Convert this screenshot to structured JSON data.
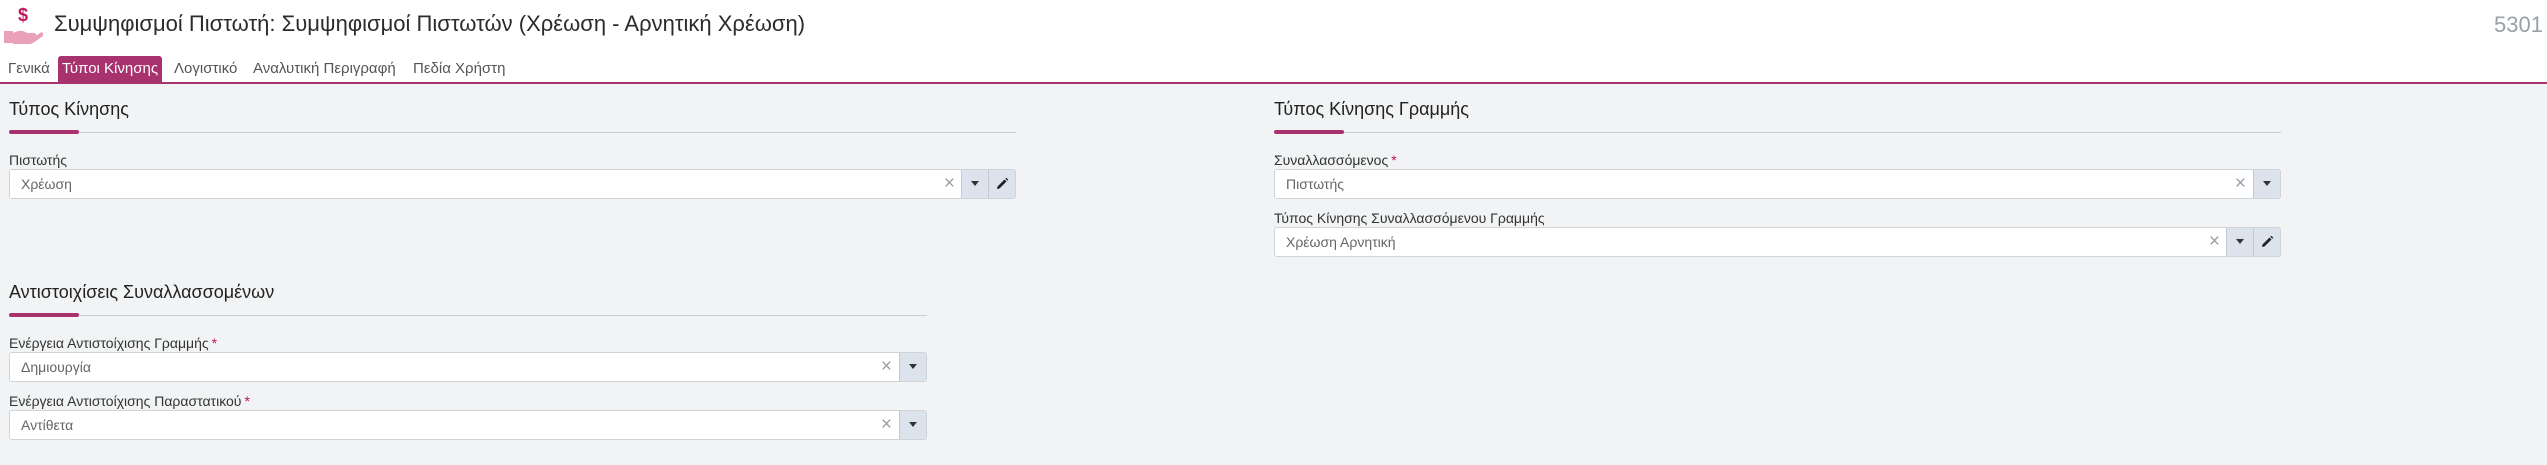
{
  "header": {
    "title": "Συμψηφισμοί Πιστωτή: Συμψηφισμοί Πιστωτών (Χρέωση - Αρνητική Χρέωση)",
    "doc_number": "5301",
    "icon": "money-hand-icon"
  },
  "tabs": [
    {
      "label": "Γενικά",
      "active": false
    },
    {
      "label": "Τύποι Κίνησης",
      "active": true
    },
    {
      "label": "Λογιστικό",
      "active": false
    },
    {
      "label": "Αναλυτική Περιγραφή",
      "active": false
    },
    {
      "label": "Πεδία Χρήστη",
      "active": false
    }
  ],
  "movement_type": {
    "title": "Τύπος Κίνησης",
    "creditor": {
      "label": "Πιστωτής",
      "value": "Χρέωση",
      "required": false
    }
  },
  "line_movement_type": {
    "title": "Τύπος Κίνησης Γραμμής",
    "counterparty": {
      "label": "Συναλλασσόμενος",
      "value": "Πιστωτής",
      "required": true
    },
    "counterparty_line_type": {
      "label": "Τύπος Κίνησης Συναλλασσόμενου Γραμμής",
      "value": "Χρέωση Αρνητική",
      "required": false
    }
  },
  "mappings": {
    "title": "Αντιστοιχίσεις Συναλλασσομένων",
    "line_mapping_action": {
      "label": "Ενέργεια Αντιστοίχισης Γραμμής",
      "value": "Δημιουργία",
      "required": true
    },
    "document_mapping_action": {
      "label": "Ενέργεια Αντιστοίχισης Παραστατικού",
      "value": "Αντίθετα",
      "required": true
    }
  },
  "colors": {
    "accent": "#a8326e",
    "required": "#c0134d",
    "background": "#f1f3f4"
  },
  "icons": {
    "clear": "close-icon",
    "dropdown": "caret-down-icon",
    "edit": "pencil-icon"
  }
}
